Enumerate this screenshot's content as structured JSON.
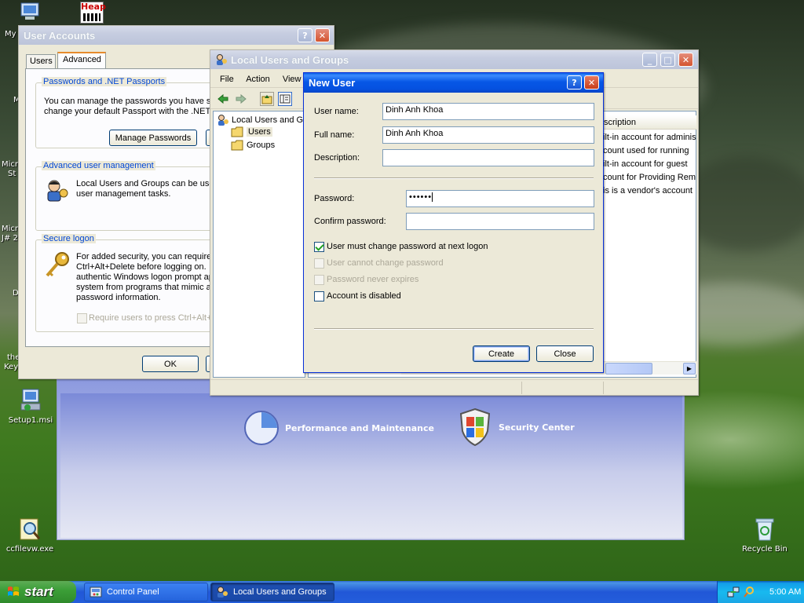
{
  "desktop": {
    "icons": [
      {
        "label": "Setup1.msi"
      },
      {
        "label": "ccfilevw.exe"
      },
      {
        "label": "Recycle Bin"
      }
    ],
    "partial_labels": [
      "My",
      "Heap",
      "M",
      "Micr",
      "St",
      "Micr",
      "J# 2",
      "D",
      "the",
      "Key"
    ]
  },
  "control_panel": {
    "categories": [
      {
        "label": "Performance and Maintenance",
        "icon": "pie-chart-icon"
      },
      {
        "label": "Security Center",
        "icon": "shield-icon"
      }
    ]
  },
  "user_accounts": {
    "title": "User Accounts",
    "tabs": [
      {
        "label": "Users"
      },
      {
        "label": "Advanced"
      }
    ],
    "active_tab": "Advanced",
    "passwords_group": {
      "title": "Passwords and .NET Passports",
      "text_line1": "You can manage the passwords you have st",
      "text_line2": "change your default Passport with the .NET",
      "button": "Manage Passwords"
    },
    "advanced_group": {
      "title": "Advanced user management",
      "text_line1": "Local Users and Groups can be used",
      "text_line2": "user management tasks."
    },
    "secure_group": {
      "title": "Secure logon",
      "lines": [
        "For added security, you can require",
        "Ctrl+Alt+Delete before logging on.",
        "authentic Windows logon prompt ap",
        "system from programs that mimic a",
        "password information."
      ],
      "checkbox_label": "Require users to press Ctrl+Alt+",
      "checkbox_checked": false
    },
    "ok_button": "OK"
  },
  "local_users": {
    "title": "Local Users and Groups",
    "menu": [
      "File",
      "Action",
      "View"
    ],
    "tree": {
      "root": "Local Users and Gr",
      "children": [
        "Users",
        "Groups"
      ],
      "selected": "Users"
    },
    "column_header": "scription",
    "descriptions": [
      "ilt-in account for adminis",
      "count used for running",
      "ilt-in account for guest",
      "count for Providing Rem",
      "is is a vendor's account"
    ]
  },
  "new_user": {
    "title": "New User",
    "fields": {
      "username_label": "User name:",
      "username_value": "Dinh Anh Khoa",
      "fullname_label": "Full name:",
      "fullname_value": "Dinh Anh Khoa",
      "description_label": "Description:",
      "description_value": "",
      "password_label": "Password:",
      "password_value": "••••••",
      "confirm_label": "Confirm password:",
      "confirm_value": ""
    },
    "options": [
      {
        "label": "User must change password at next logon",
        "checked": true,
        "enabled": true
      },
      {
        "label": "User cannot change password",
        "checked": false,
        "enabled": false
      },
      {
        "label": "Password never expires",
        "checked": false,
        "enabled": false
      },
      {
        "label": "Account is disabled",
        "checked": false,
        "enabled": true
      }
    ],
    "create_button": "Create",
    "close_button": "Close"
  },
  "taskbar": {
    "start_label": "start",
    "tasks": [
      {
        "label": "Control Panel",
        "active": false
      },
      {
        "label": "Local Users and Groups",
        "active": true
      }
    ],
    "clock": "5:00 AM"
  }
}
